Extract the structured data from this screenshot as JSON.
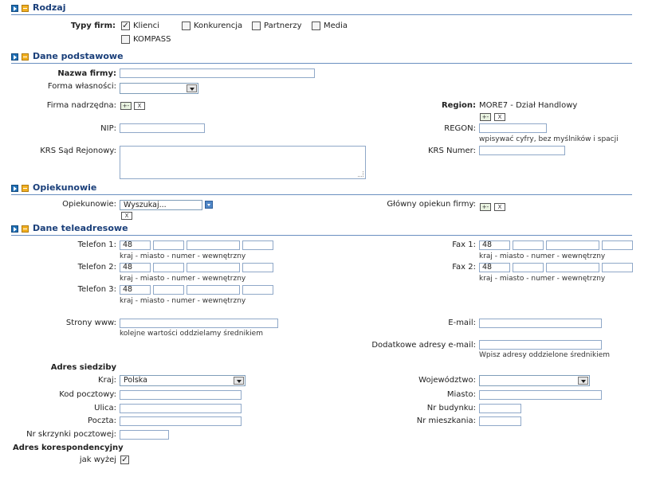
{
  "sections": {
    "rodzaj": "Rodzaj",
    "dane_podstawowe": "Dane podstawowe",
    "opiekunowie": "Opiekunowie",
    "dane_teleadresowe": "Dane teleadresowe"
  },
  "typy_firm": {
    "label": "Typy firm:",
    "options": [
      {
        "label": "Klienci",
        "checked": true
      },
      {
        "label": "Konkurencja",
        "checked": false
      },
      {
        "label": "Partnerzy",
        "checked": false
      },
      {
        "label": "Media",
        "checked": false
      },
      {
        "label": "KOMPASS",
        "checked": false
      }
    ]
  },
  "basic": {
    "nazwa_label": "Nazwa firmy:",
    "nazwa_value": "",
    "forma_label": "Forma własności:",
    "forma_value": "",
    "firma_nadrzedna_label": "Firma nadrzędna:",
    "region_label": "Region:",
    "region_value": "MORE7 - Dział Handlowy",
    "nip_label": "NIP:",
    "regon_label": "REGON:",
    "regon_hint": "wpisywać cyfry, bez myślników i spacji",
    "krs_sad_label": "KRS Sąd Rejonowy:",
    "krs_numer_label": "KRS Numer:",
    "btn_add": "+-",
    "btn_remove": "X"
  },
  "opiekunowie": {
    "label": "Opiekunowie:",
    "select_value": "Wyszukaj...",
    "glowny_label": "Główny opiekun firmy:"
  },
  "tele": {
    "telefon1_label": "Telefon 1:",
    "telefon2_label": "Telefon 2:",
    "telefon3_label": "Telefon 3:",
    "fax1_label": "Fax 1:",
    "fax2_label": "Fax 2:",
    "prefix": "48",
    "phone_hint": "kraj - miasto - numer - wewnętrzny",
    "www_label": "Strony www:",
    "www_hint": "kolejne wartości oddzielamy średnikiem",
    "email_label": "E-mail:",
    "extra_email_label": "Dodatkowe adresy e-mail:",
    "extra_email_hint": "Wpisz adresy oddzielone średnikiem"
  },
  "address": {
    "heading": "Adres siedziby",
    "kraj_label": "Kraj:",
    "kraj_value": "Polska",
    "wojewodztwo_label": "Województwo:",
    "kod_label": "Kod pocztowy:",
    "miasto_label": "Miasto:",
    "ulica_label": "Ulica:",
    "nr_budynku_label": "Nr budynku:",
    "poczta_label": "Poczta:",
    "nr_mieszkania_label": "Nr mieszkania:",
    "skrytka_label": "Nr skrzynki pocztowej:",
    "koresp_heading": "Adres korespondencyjny",
    "jak_wyzej_label": "jak wyżej",
    "jak_wyzej_checked": true
  }
}
